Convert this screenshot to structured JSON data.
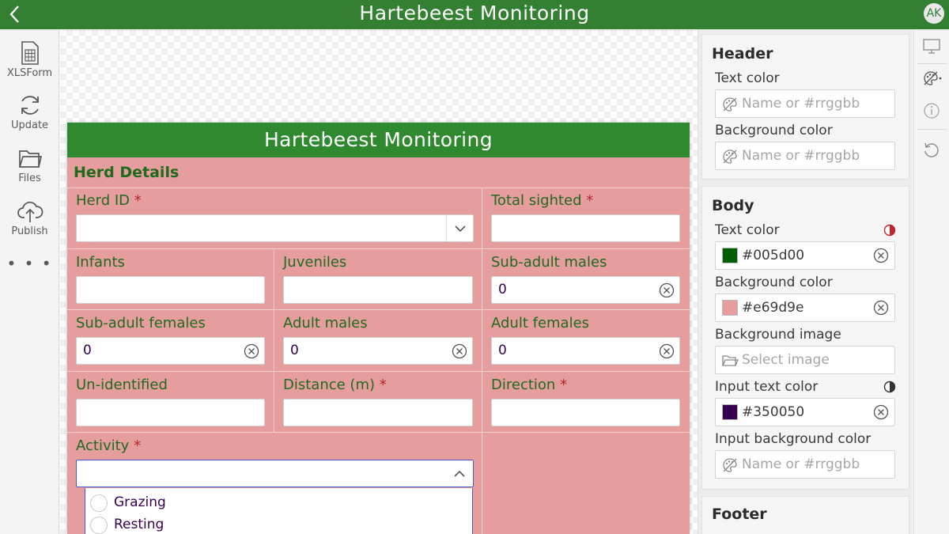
{
  "app": {
    "title": "Hartebeest Monitoring",
    "avatar_initials": "AK"
  },
  "left_rail": [
    {
      "label": "XLSForm",
      "icon": "spreadsheet-icon"
    },
    {
      "label": "Update",
      "icon": "refresh-icon"
    },
    {
      "label": "Files",
      "icon": "folder-icon"
    },
    {
      "label": "Publish",
      "icon": "cloud-upload-icon"
    }
  ],
  "left_rail_more": "• • •",
  "form": {
    "header_title": "Hartebeest Monitoring",
    "group_title": "Herd Details",
    "required_mark": "*",
    "questions": {
      "herd_id": {
        "label": "Herd ID",
        "value": ""
      },
      "total_sighted": {
        "label": "Total sighted",
        "value": ""
      },
      "infants": {
        "label": "Infants",
        "value": ""
      },
      "juveniles": {
        "label": "Juveniles",
        "value": ""
      },
      "subadult_males": {
        "label": "Sub-adult males",
        "value": "0"
      },
      "subadult_females": {
        "label": "Sub-adult females",
        "value": "0"
      },
      "adult_males": {
        "label": "Adult males",
        "value": "0"
      },
      "adult_females": {
        "label": "Adult females",
        "value": "0"
      },
      "unidentified": {
        "label": "Un-identified",
        "value": ""
      },
      "distance": {
        "label": "Distance (m)",
        "value": ""
      },
      "direction": {
        "label": "Direction",
        "value": ""
      },
      "activity": {
        "label": "Activity",
        "value": "",
        "options": [
          "Grazing",
          "Resting"
        ]
      }
    }
  },
  "style_panel": {
    "header": {
      "title": "Header",
      "text_color": {
        "label": "Text color",
        "placeholder": "Name or #rrggbb"
      },
      "background_color": {
        "label": "Background color",
        "placeholder": "Name or #rrggbb"
      }
    },
    "body": {
      "title": "Body",
      "text_color": {
        "label": "Text color",
        "value": "#005d00"
      },
      "background_color": {
        "label": "Background color",
        "value": "#e69d9e"
      },
      "background_image": {
        "label": "Background image",
        "placeholder": "Select image"
      },
      "input_text_color": {
        "label": "Input text color",
        "value": "#350050"
      },
      "input_background_color": {
        "label": "Input background color",
        "placeholder": "Name or #rrggbb"
      }
    },
    "footer": {
      "title": "Footer"
    }
  },
  "colors": {
    "app_bar": "#338033",
    "form_background": "#e69d9e",
    "body_text": "#005d00",
    "input_text": "#350050",
    "required": "#b0262a"
  }
}
